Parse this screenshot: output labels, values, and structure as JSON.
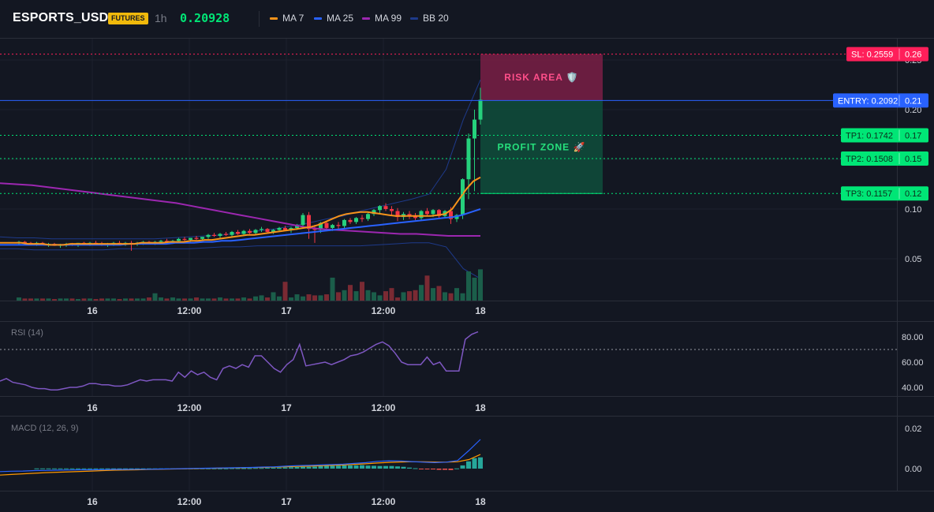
{
  "header": {
    "symbol": "ESPORTS_USDT",
    "badge": "FUTURES",
    "timeframe": "1h",
    "last_price": "0.20928",
    "indicators": [
      {
        "label": "MA 7",
        "color": "#f7931a"
      },
      {
        "label": "MA 25",
        "color": "#2962ff"
      },
      {
        "label": "MA 99",
        "color": "#9c27b0"
      },
      {
        "label": "BB 20",
        "color": "#1e3a8a"
      }
    ]
  },
  "colors": {
    "up": "#26d07c",
    "down": "#f23645",
    "up_volume": "#1b5e4a",
    "down_volume": "#7a2a33",
    "entry": "#2962ff",
    "sl": "#ff1f5a",
    "tp": "#00e676",
    "rsi": "#7e57c2",
    "macd_line": "#2962ff",
    "signal_line": "#ff9800"
  },
  "levels": {
    "sl": {
      "label": "SL: 0.2559",
      "axis": "0.26",
      "value": 0.2559
    },
    "entry": {
      "label": "ENTRY: 0.2092",
      "axis": "0.21",
      "value": 0.2092
    },
    "tp1": {
      "label": "TP1: 0.1742",
      "axis": "0.17",
      "value": 0.1742
    },
    "tp2": {
      "label": "TP2: 0.1508",
      "axis": "0.15",
      "value": 0.1508
    },
    "tp3": {
      "label": "TP3: 0.1157",
      "axis": "0.12",
      "value": 0.1157
    }
  },
  "zones": {
    "risk_label": "RISK AREA 🛡️",
    "profit_label": "PROFIT ZONE 🚀"
  },
  "panes": {
    "rsi_title": "RSI (14)",
    "macd_title": "MACD (12, 26, 9)"
  },
  "chart_data": [
    {
      "type": "candlestick",
      "name": "price",
      "time_labels": [
        "16",
        "12:00",
        "17",
        "12:00",
        "18"
      ],
      "y_ticks": [
        "0.25",
        "0.20",
        "0.15",
        "0.10",
        "0.05"
      ],
      "ylim": [
        0.0,
        0.265
      ],
      "ohlc": [
        [
          0.066,
          0.068,
          0.064,
          0.067
        ],
        [
          0.067,
          0.068,
          0.065,
          0.066
        ],
        [
          0.066,
          0.067,
          0.064,
          0.065
        ],
        [
          0.065,
          0.067,
          0.063,
          0.066
        ],
        [
          0.066,
          0.067,
          0.064,
          0.064
        ],
        [
          0.064,
          0.066,
          0.062,
          0.065
        ],
        [
          0.065,
          0.066,
          0.063,
          0.063
        ],
        [
          0.063,
          0.065,
          0.061,
          0.064
        ],
        [
          0.064,
          0.066,
          0.062,
          0.065
        ],
        [
          0.065,
          0.066,
          0.063,
          0.064
        ],
        [
          0.064,
          0.066,
          0.062,
          0.066
        ],
        [
          0.066,
          0.067,
          0.064,
          0.065
        ],
        [
          0.065,
          0.067,
          0.063,
          0.066
        ],
        [
          0.066,
          0.068,
          0.064,
          0.065
        ],
        [
          0.065,
          0.067,
          0.063,
          0.064
        ],
        [
          0.064,
          0.066,
          0.062,
          0.065
        ],
        [
          0.065,
          0.067,
          0.063,
          0.066
        ],
        [
          0.066,
          0.068,
          0.064,
          0.065
        ],
        [
          0.065,
          0.067,
          0.063,
          0.066
        ],
        [
          0.066,
          0.068,
          0.058,
          0.065
        ],
        [
          0.065,
          0.067,
          0.063,
          0.066
        ],
        [
          0.066,
          0.068,
          0.064,
          0.067
        ],
        [
          0.067,
          0.068,
          0.065,
          0.066
        ],
        [
          0.066,
          0.068,
          0.064,
          0.067
        ],
        [
          0.067,
          0.069,
          0.065,
          0.068
        ],
        [
          0.068,
          0.07,
          0.066,
          0.067
        ],
        [
          0.067,
          0.069,
          0.065,
          0.068
        ],
        [
          0.068,
          0.071,
          0.066,
          0.07
        ],
        [
          0.07,
          0.072,
          0.068,
          0.069
        ],
        [
          0.069,
          0.071,
          0.067,
          0.071
        ],
        [
          0.071,
          0.073,
          0.069,
          0.07
        ],
        [
          0.07,
          0.072,
          0.068,
          0.072
        ],
        [
          0.072,
          0.075,
          0.07,
          0.074
        ],
        [
          0.074,
          0.076,
          0.072,
          0.073
        ],
        [
          0.073,
          0.076,
          0.071,
          0.075
        ],
        [
          0.075,
          0.077,
          0.073,
          0.074
        ],
        [
          0.074,
          0.078,
          0.072,
          0.077
        ],
        [
          0.077,
          0.079,
          0.074,
          0.075
        ],
        [
          0.075,
          0.079,
          0.073,
          0.078
        ],
        [
          0.078,
          0.08,
          0.075,
          0.076
        ],
        [
          0.076,
          0.08,
          0.074,
          0.079
        ],
        [
          0.079,
          0.082,
          0.077,
          0.08
        ],
        [
          0.08,
          0.081,
          0.076,
          0.077
        ],
        [
          0.077,
          0.08,
          0.075,
          0.079
        ],
        [
          0.079,
          0.082,
          0.077,
          0.081
        ],
        [
          0.081,
          0.083,
          0.078,
          0.079
        ],
        [
          0.079,
          0.082,
          0.076,
          0.081
        ],
        [
          0.081,
          0.085,
          0.079,
          0.084
        ],
        [
          0.084,
          0.096,
          0.082,
          0.094
        ],
        [
          0.094,
          0.097,
          0.07,
          0.08
        ],
        [
          0.08,
          0.084,
          0.066,
          0.079
        ],
        [
          0.079,
          0.087,
          0.076,
          0.086
        ],
        [
          0.086,
          0.088,
          0.08,
          0.081
        ],
        [
          0.081,
          0.085,
          0.078,
          0.084
        ],
        [
          0.084,
          0.087,
          0.08,
          0.083
        ],
        [
          0.083,
          0.09,
          0.081,
          0.089
        ],
        [
          0.089,
          0.091,
          0.085,
          0.087
        ],
        [
          0.087,
          0.092,
          0.085,
          0.091
        ],
        [
          0.091,
          0.094,
          0.087,
          0.09
        ],
        [
          0.09,
          0.096,
          0.088,
          0.095
        ],
        [
          0.095,
          0.1,
          0.093,
          0.099
        ],
        [
          0.099,
          0.104,
          0.096,
          0.103
        ],
        [
          0.103,
          0.106,
          0.098,
          0.1
        ],
        [
          0.1,
          0.103,
          0.094,
          0.098
        ],
        [
          0.098,
          0.101,
          0.088,
          0.092
        ],
        [
          0.092,
          0.097,
          0.089,
          0.095
        ],
        [
          0.095,
          0.098,
          0.09,
          0.093
        ],
        [
          0.093,
          0.096,
          0.089,
          0.091
        ],
        [
          0.091,
          0.099,
          0.089,
          0.098
        ],
        [
          0.098,
          0.101,
          0.093,
          0.095
        ],
        [
          0.095,
          0.1,
          0.092,
          0.099
        ],
        [
          0.099,
          0.1,
          0.091,
          0.093
        ],
        [
          0.093,
          0.099,
          0.091,
          0.098
        ],
        [
          0.098,
          0.102,
          0.085,
          0.09
        ],
        [
          0.09,
          0.095,
          0.087,
          0.094
        ],
        [
          0.094,
          0.131,
          0.09,
          0.13
        ],
        [
          0.13,
          0.176,
          0.11,
          0.171
        ],
        [
          0.171,
          0.2,
          0.118,
          0.19
        ],
        [
          0.19,
          0.222,
          0.185,
          0.21
        ]
      ],
      "volume": [
        3,
        2,
        2,
        2,
        2,
        2,
        1.5,
        2,
        2,
        2,
        1.5,
        2,
        2,
        1.5,
        2,
        2,
        2,
        1.5,
        2,
        2,
        2,
        2,
        3,
        7,
        3,
        2,
        3,
        2,
        2,
        2,
        3,
        2,
        2,
        2,
        3,
        2,
        2,
        2,
        3,
        2,
        4,
        5,
        3,
        8,
        4,
        18,
        3,
        6,
        4,
        6,
        5,
        5,
        6,
        22,
        8,
        10,
        15,
        9,
        18,
        10,
        8,
        5,
        9,
        12,
        3,
        8,
        9,
        10,
        15,
        24,
        12,
        14,
        8,
        7,
        12,
        7,
        28,
        22,
        30,
        42,
        50,
        20
      ],
      "ma7": [
        0.066,
        0.066,
        0.066,
        0.066,
        0.065,
        0.065,
        0.065,
        0.064,
        0.064,
        0.064,
        0.065,
        0.065,
        0.065,
        0.065,
        0.065,
        0.065,
        0.065,
        0.065,
        0.065,
        0.065,
        0.066,
        0.066,
        0.066,
        0.066,
        0.067,
        0.067,
        0.067,
        0.068,
        0.068,
        0.069,
        0.069,
        0.07,
        0.071,
        0.072,
        0.073,
        0.074,
        0.074,
        0.075,
        0.076,
        0.077,
        0.078,
        0.079,
        0.08,
        0.081,
        0.082,
        0.084,
        0.087,
        0.09,
        0.093,
        0.095,
        0.096,
        0.097,
        0.097,
        0.096,
        0.095,
        0.094,
        0.093,
        0.093,
        0.093,
        0.093,
        0.093,
        0.093,
        0.094,
        0.095,
        0.1,
        0.11,
        0.12,
        0.128,
        0.132
      ],
      "ma25": [
        0.064,
        0.064,
        0.064,
        0.064,
        0.064,
        0.064,
        0.064,
        0.064,
        0.064,
        0.064,
        0.064,
        0.064,
        0.064,
        0.064,
        0.065,
        0.065,
        0.065,
        0.065,
        0.065,
        0.066,
        0.066,
        0.066,
        0.067,
        0.067,
        0.068,
        0.068,
        0.069,
        0.07,
        0.071,
        0.072,
        0.073,
        0.074,
        0.075,
        0.076,
        0.077,
        0.078,
        0.079,
        0.08,
        0.081,
        0.082,
        0.083,
        0.084,
        0.085,
        0.086,
        0.087,
        0.088,
        0.089,
        0.09,
        0.091,
        0.092,
        0.094,
        0.097,
        0.1
      ],
      "ma99": [
        0.126,
        0.125,
        0.124,
        0.122,
        0.12,
        0.118,
        0.116,
        0.114,
        0.112,
        0.11,
        0.108,
        0.106,
        0.103,
        0.1,
        0.097,
        0.094,
        0.091,
        0.088,
        0.085,
        0.082,
        0.08,
        0.079,
        0.078,
        0.077,
        0.076,
        0.075,
        0.075,
        0.074,
        0.073,
        0.073,
        0.073
      ],
      "bb_upper": [
        0.072,
        0.071,
        0.071,
        0.07,
        0.07,
        0.07,
        0.07,
        0.07,
        0.07,
        0.07,
        0.071,
        0.072,
        0.073,
        0.074,
        0.076,
        0.078,
        0.08,
        0.083,
        0.086,
        0.09,
        0.093,
        0.098,
        0.102,
        0.106,
        0.11,
        0.115,
        0.14,
        0.19,
        0.23
      ],
      "bb_lower": [
        0.06,
        0.06,
        0.059,
        0.059,
        0.059,
        0.059,
        0.059,
        0.06,
        0.06,
        0.06,
        0.06,
        0.06,
        0.061,
        0.062,
        0.062,
        0.063,
        0.063,
        0.063,
        0.063,
        0.063,
        0.063,
        0.063,
        0.064,
        0.065,
        0.066,
        0.066,
        0.062,
        0.04,
        0.03
      ]
    },
    {
      "type": "line",
      "name": "RSI (14)",
      "y_ticks": [
        "80.00",
        "60.00",
        "40.00"
      ],
      "ylim": [
        30,
        90
      ],
      "overbought": 70,
      "values": [
        45,
        47,
        44,
        43,
        42,
        40,
        39,
        39,
        38,
        38,
        39,
        40,
        40,
        41,
        43,
        43,
        42,
        42,
        41,
        41,
        42,
        44,
        46,
        45,
        46,
        46,
        46,
        45,
        52,
        48,
        53,
        50,
        52,
        48,
        46,
        55,
        57,
        55,
        58,
        56,
        65,
        65,
        60,
        55,
        52,
        58,
        62,
        74,
        57,
        58,
        59,
        60,
        58,
        60,
        62,
        65,
        66,
        68,
        71,
        74,
        76,
        73,
        67,
        60,
        58,
        58,
        58,
        64,
        58,
        60,
        53,
        53,
        53,
        78,
        82,
        84
      ]
    },
    {
      "type": "bar+line",
      "name": "MACD (12, 26, 9)",
      "y_ticks": [
        "0.02",
        "0.00"
      ],
      "ylim": [
        -0.0055,
        0.0235
      ],
      "histogram": [
        0.0001,
        0.0001,
        0.0001,
        0.0001,
        0.0001,
        0.0001,
        0.0001,
        0.0001,
        0.0001,
        0.0001,
        0.0001,
        0.0001,
        0.0001,
        0.0001,
        0.0001,
        0.0001,
        0.0001,
        0.0001,
        0.0001,
        0.0001,
        0.0001,
        0.0001,
        0.0001,
        0.0001,
        0.0001,
        0.0001,
        0.0001,
        0.0001,
        0.0001,
        0.0001,
        0.0001,
        0.0001,
        0.0001,
        0.0002,
        0.0002,
        0.0002,
        0.0002,
        0.0003,
        0.0003,
        0.0004,
        0.0005,
        0.0005,
        0.0006,
        0.0007,
        0.0008,
        0.0009,
        0.0009,
        0.001,
        0.0012,
        0.0014,
        0.0014,
        0.0015,
        0.0016,
        0.0016,
        0.0016,
        0.0017,
        0.0015,
        0.0014,
        0.0013,
        0.0013,
        0.0013,
        0.0011,
        0.0009,
        0.0005,
        0.0002,
        -0.0002,
        -0.0002,
        -0.0004,
        -0.0006,
        -0.0006,
        -0.0007,
        0.0001,
        0.0016,
        0.0036,
        0.0052,
        0.0056
      ],
      "macd": [
        -0.0015,
        -0.0013,
        -0.0012,
        -0.001,
        -0.0009,
        -0.0008,
        -0.0007,
        -0.0006,
        -0.0006,
        -0.0005,
        -0.0004,
        -0.0004,
        -0.0003,
        -0.0003,
        -0.0002,
        -0.0001,
        0.0,
        0.0001,
        0.0002,
        0.0003,
        0.0004,
        0.0005,
        0.0006,
        0.0008,
        0.0009,
        0.0012,
        0.0015,
        0.0016,
        0.0018,
        0.002,
        0.0022,
        0.0026,
        0.003,
        0.0036,
        0.0039,
        0.0038,
        0.0035,
        0.0032,
        0.003,
        0.0032,
        0.004,
        0.009,
        0.0145
      ],
      "signal": [
        -0.0032,
        -0.0029,
        -0.0026,
        -0.0023,
        -0.002,
        -0.0018,
        -0.0016,
        -0.0014,
        -0.0012,
        -0.001,
        -0.0008,
        -0.0007,
        -0.0006,
        -0.0004,
        -0.0003,
        -0.0002,
        -0.0001,
        0.0,
        0.0001,
        0.0002,
        0.0003,
        0.0004,
        0.0005,
        0.0006,
        0.0008,
        0.0009,
        0.0011,
        0.0012,
        0.0014,
        0.0016,
        0.0018,
        0.0021,
        0.0024,
        0.0028,
        0.0031,
        0.0033,
        0.0034,
        0.0034,
        0.0033,
        0.0032,
        0.0034,
        0.0045,
        0.007
      ]
    }
  ]
}
